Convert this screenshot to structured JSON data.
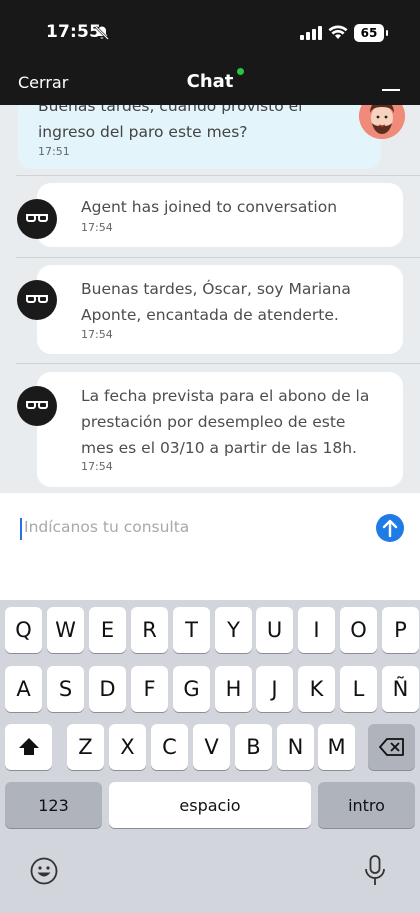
{
  "status_bar": {
    "time": "17:55",
    "battery": "65"
  },
  "header": {
    "close_label": "Cerrar",
    "title": "Chat"
  },
  "messages": {
    "user": {
      "text": "Buenas tardes, cuándo provisto el ingreso del paro este mes?",
      "time": "17:51"
    },
    "agent": [
      {
        "text": "Agent has joined to conversation",
        "time": "17:54"
      },
      {
        "text": "Buenas tardes, Óscar, soy Mariana Aponte, encantada de atenderte.",
        "time": "17:54"
      },
      {
        "text": "La fecha prevista para el abono de la prestación por desempleo de este mes es el 03/10 a partir de las 18h.",
        "time": "17:54"
      }
    ]
  },
  "composer": {
    "placeholder": "Indícanos tu consulta"
  },
  "keyboard": {
    "row1": [
      "Q",
      "W",
      "E",
      "R",
      "T",
      "Y",
      "U",
      "I",
      "O",
      "P"
    ],
    "row2": [
      "A",
      "S",
      "D",
      "F",
      "G",
      "H",
      "J",
      "K",
      "L",
      "Ñ"
    ],
    "row3": [
      "Z",
      "X",
      "C",
      "V",
      "B",
      "N",
      "M"
    ],
    "numbers_label": "123",
    "space_label": "espacio",
    "return_label": "intro"
  },
  "colors": {
    "header_bg": "#181818",
    "online": "#2bc34a",
    "send": "#1f7be6",
    "user_bubble": "#e3f5fb"
  }
}
